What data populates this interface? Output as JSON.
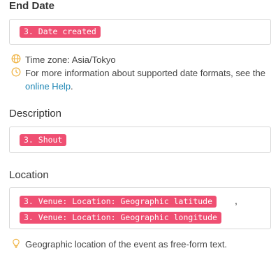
{
  "end_date": {
    "title": "End Date",
    "token": "3. Date created",
    "timezone_hint": "Time zone: Asia/Tokyo",
    "formats_hint": "For more information about supported date formats, see the",
    "formats_link": "online Help",
    "formats_tail": "."
  },
  "description": {
    "title": "Description",
    "token": "3. Shout"
  },
  "location": {
    "title": "Location",
    "token_latitude": "3. Venue: Location: Geographic latitude",
    "separator": ",",
    "token_longitude": "3. Venue: Location: Geographic longitude",
    "hint": "Geographic location of the event as free-form text."
  },
  "colors": {
    "token_bg": "#ef4f72",
    "link": "#1f87b5",
    "globe_icon": "#f0b64a",
    "clock_icon": "#f0b64a",
    "bulb_icon": "#f0b64a"
  },
  "icons": [
    "globe-icon",
    "clock-icon",
    "lightbulb-icon"
  ]
}
